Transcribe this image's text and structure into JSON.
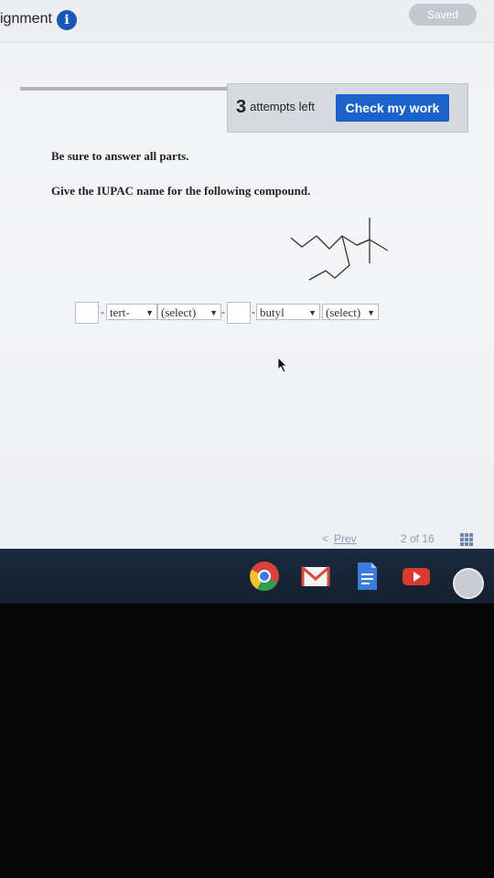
{
  "header": {
    "title": "ignment",
    "saved_label": "Saved"
  },
  "toolbar": {
    "attempts_count": "3",
    "attempts_text": "attempts left",
    "check_button": "Check my work"
  },
  "question": {
    "instruction": "Be sure to answer all parts.",
    "prompt": "Give the IUPAC name for the following compound."
  },
  "answer": {
    "sep1": "-",
    "sel1": "tert-",
    "sel2": "(select)",
    "sep2": "-",
    "sep3": "-",
    "sel3": "butyl",
    "sel4": "(select)"
  },
  "pager": {
    "prev_arrow": "<",
    "prev_label": "Prev",
    "page_indicator": "2 of 16"
  },
  "icons": {
    "info": "info-icon",
    "grid": "grid-icon",
    "chrome": "chrome-icon",
    "gmail": "gmail-icon",
    "docs": "docs-icon",
    "youtube": "youtube-icon",
    "avatar": "avatar-icon"
  },
  "colors": {
    "accent": "#1b63c8",
    "info": "#1a55b8",
    "saved_pill": "#c4c7cd"
  }
}
